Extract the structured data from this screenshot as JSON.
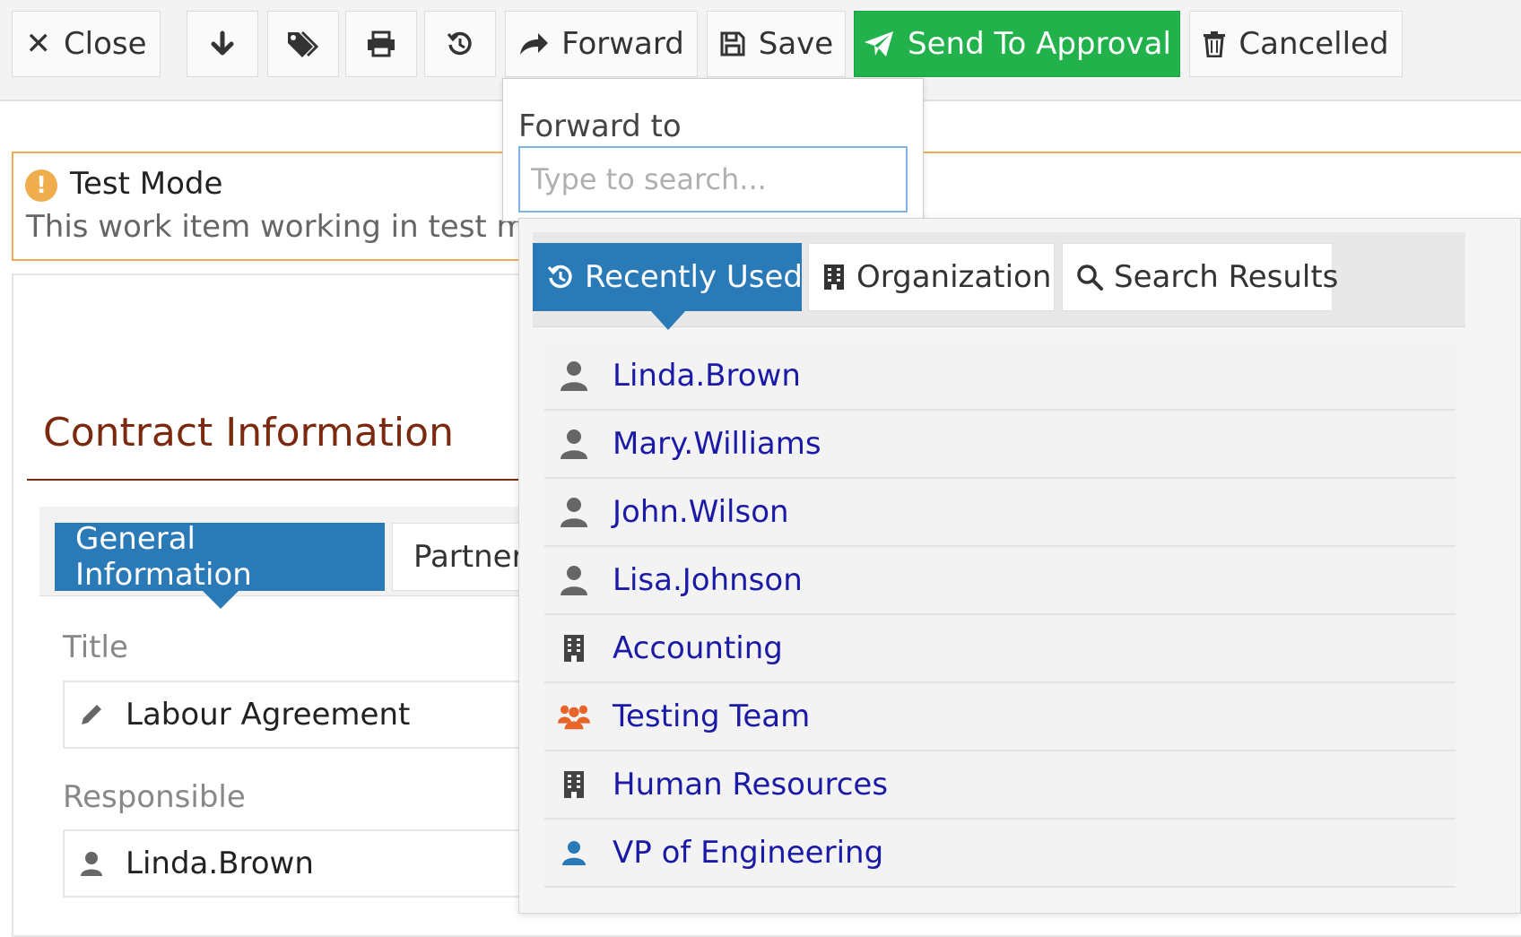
{
  "toolbar": {
    "close_label": "Close",
    "forward_label": "Forward",
    "save_label": "Save",
    "send_label": "Send To Approval",
    "cancelled_label": "Cancelled"
  },
  "banner": {
    "title": "Test Mode",
    "message": "This work item working in test mode"
  },
  "section": {
    "title": "Contract Information",
    "tabs": [
      "General Information",
      "Partners"
    ]
  },
  "form": {
    "title_label": "Title",
    "title_value": "Labour Agreement",
    "responsible_label": "Responsible",
    "responsible_value": "Linda.Brown"
  },
  "forward_popup": {
    "label": "Forward to",
    "placeholder": "Type to search..."
  },
  "picker": {
    "tabs": [
      "Recently Used",
      "Organization",
      "Search Results"
    ],
    "items": [
      {
        "label": "Linda.Brown",
        "icon": "user-icon"
      },
      {
        "label": "Mary.Williams",
        "icon": "user-icon"
      },
      {
        "label": "John.Wilson",
        "icon": "user-icon"
      },
      {
        "label": "Lisa.Johnson",
        "icon": "user-icon"
      },
      {
        "label": "Accounting",
        "icon": "building-icon"
      },
      {
        "label": "Testing Team",
        "icon": "users-group-icon"
      },
      {
        "label": "Human Resources",
        "icon": "building-icon"
      },
      {
        "label": "VP of Engineering",
        "icon": "user-blue-icon"
      }
    ]
  },
  "colors": {
    "primary_green": "#21b24c",
    "tab_blue": "#2a7ab8",
    "warning_orange": "#f0ad4e",
    "section_title": "#7b2a10",
    "link_blue": "#1a1aa6"
  }
}
